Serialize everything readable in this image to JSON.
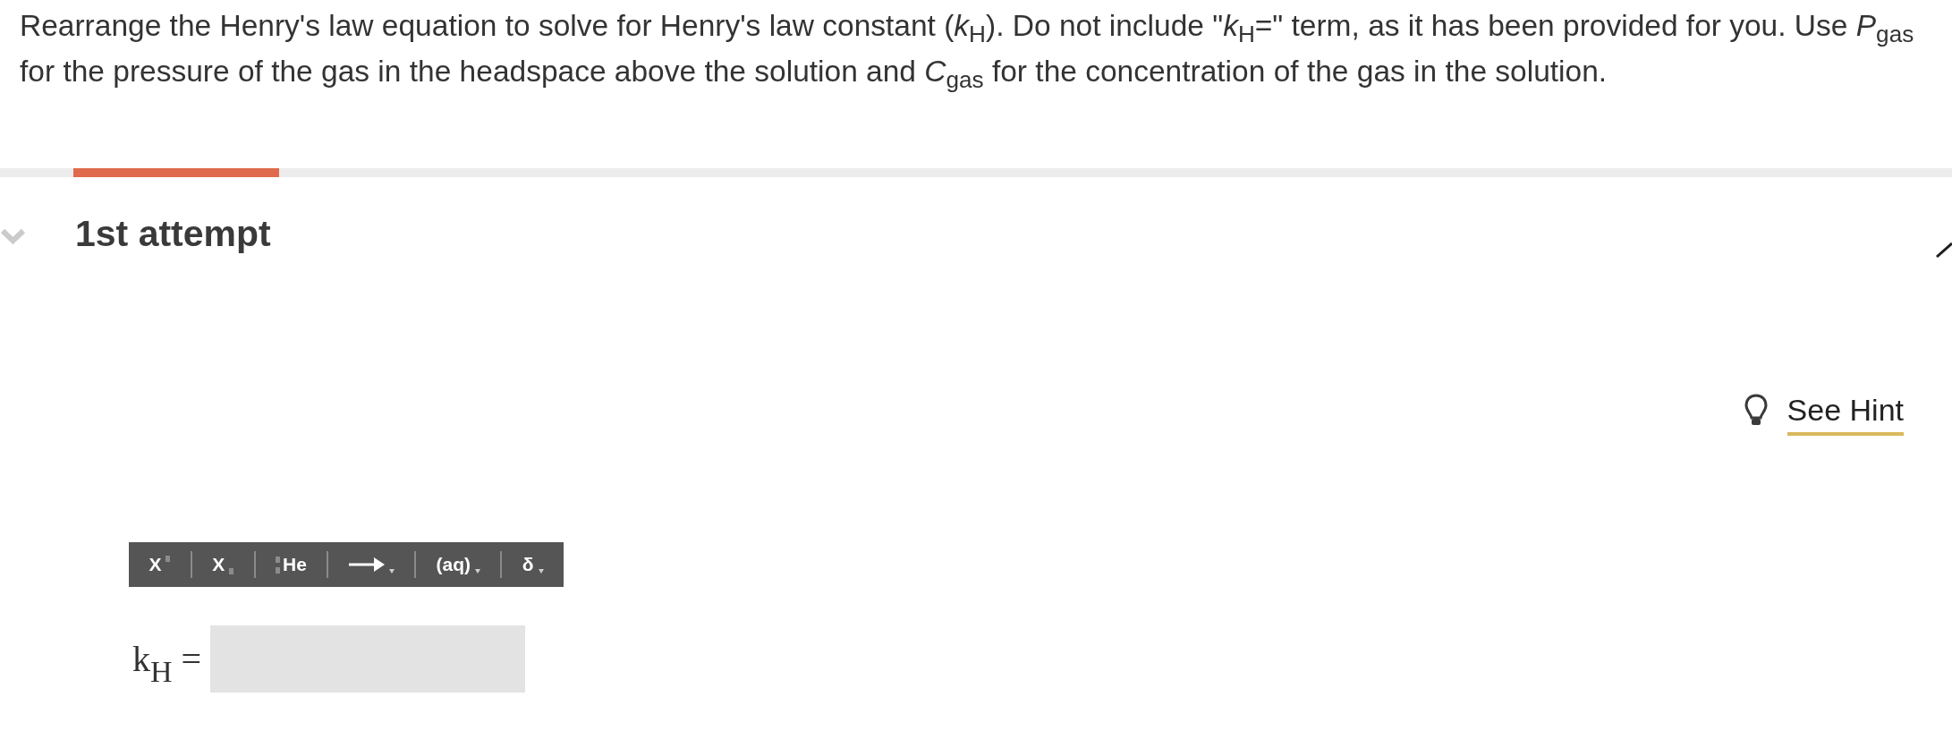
{
  "question": {
    "text": "Rearrange the Henry's law equation to solve for Henry's law constant (*k*$_{H}$). Do not include \"*k*$_{H}$=\" term, as it has been provided for you. Use *P*$_{gas}$ for the pressure of the gas in the headspace above the solution and *C*$_{gas}$ for the concentration of the gas in the solution."
  },
  "attempts": [
    {
      "label": "1st attempt",
      "selected": true,
      "expanded": true
    }
  ],
  "hint": {
    "label": "See Hint"
  },
  "toolbar": [
    {
      "kind": "superscript",
      "label": "X",
      "dropdown": false
    },
    {
      "kind": "subscript",
      "label": "X",
      "dropdown": false
    },
    {
      "kind": "isotope",
      "label": "He",
      "dropdown": false
    },
    {
      "kind": "arrow",
      "dropdown": true
    },
    {
      "kind": "state",
      "label": "(aq)",
      "dropdown": true
    },
    {
      "kind": "greek",
      "label": "δ",
      "dropdown": true
    }
  ],
  "answer": {
    "label": "k$_{H}$ ="
  }
}
